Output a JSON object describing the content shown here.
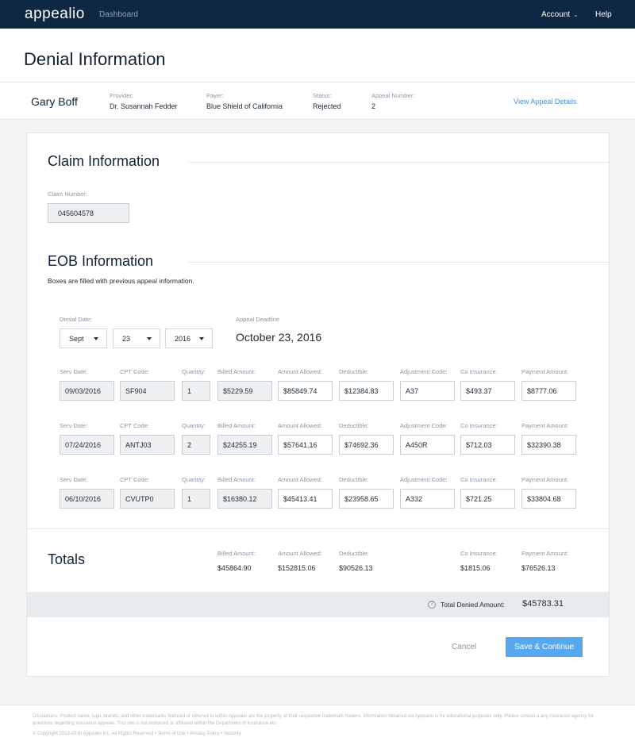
{
  "nav": {
    "brand": "appealio",
    "dashboard": "Dashboard",
    "account": "Account",
    "help": "Help"
  },
  "page": {
    "title": "Denial Information"
  },
  "patient": {
    "name": "Gary Boff",
    "provider_label": "Provider:",
    "provider": "Dr. Susannah Fedder",
    "payer_label": "Payer:",
    "payer": "Blue Shield of California",
    "status_label": "Status:",
    "status": "Rejected",
    "appeal_number_label": "Appeal Number:",
    "appeal_number": "2",
    "view_details": "View Appeal Details"
  },
  "claim": {
    "title": "Claim Information",
    "number_label": "Claim Number:",
    "number": "045604578"
  },
  "eob": {
    "title": "EOB Information",
    "note": "Boxes are filled with previous appeal information.",
    "denial_date_label": "Denial Date:",
    "month": "Sept",
    "day": "23",
    "year": "2016",
    "deadline_label": "Appeal Deadline",
    "deadline": "October 23, 2016",
    "labels": {
      "serv_date": "Serv Date:",
      "cpt_code": "CPT Code:",
      "quantity": "Quantity:",
      "billed": "Billed Amount:",
      "allowed": "Amount Allowed:",
      "deductible": "Deductible:",
      "adjustment": "Adjustment Code:",
      "co_insurance": "Co Insurance:",
      "payment": "Payment Amount:"
    },
    "rows": [
      {
        "serv_date": "09/03/2016",
        "cpt_code": "SF904",
        "quantity": "1",
        "billed": "$5229.59",
        "allowed": "$85849.74",
        "deductible": "$12384.83",
        "adjustment": "A37",
        "co_insurance": "$493.37",
        "payment": "$8777.06"
      },
      {
        "serv_date": "07/24/2016",
        "cpt_code": "ANTJ03",
        "quantity": "2",
        "billed": "$24255.19",
        "allowed": "$57641.16",
        "deductible": "$74692.36",
        "adjustment": "A450R",
        "co_insurance": "$712.03",
        "payment": "$32390.38"
      },
      {
        "serv_date": "06/10/2016",
        "cpt_code": "CVUTP0",
        "quantity": "1",
        "billed": "$16380.12",
        "allowed": "$45413.41",
        "deductible": "$23958.65",
        "adjustment": "A332",
        "co_insurance": "$721.25",
        "payment": "$33804.68"
      }
    ]
  },
  "totals": {
    "title": "Totals",
    "billed_label": "Billed Amount:",
    "billed": "$45864.90",
    "allowed_label": "Amount Allowed:",
    "allowed": "$152815.06",
    "deductible_label": "Deductible:",
    "deductible": "$90526.13",
    "co_insurance_label": "Co Insurance:",
    "co_insurance": "$1815.06",
    "payment_label": "Payment Amount:",
    "payment": "$76526.13",
    "denied_label": "Total Denied Amount:",
    "denied": "$45783.31"
  },
  "actions": {
    "cancel": "Cancel",
    "save": "Save & Continue"
  },
  "footer": {
    "disclaimer": "Disclaimers: Product name, logo, brands, and other trademarks featured or referred to within Appealio are the property of their respective trademark holders. Information obtained via Appealio is for educational purposes only. Please consult a any insurance agency for questions regarding insurance appeals. This site is not endorsed or affiliated within the Department of Insurance etc.",
    "copyright": "© Copyright 2013-2016 Appealio Inc. All Rights Reserved • Terms of Use • Privacy Policy • Security"
  }
}
